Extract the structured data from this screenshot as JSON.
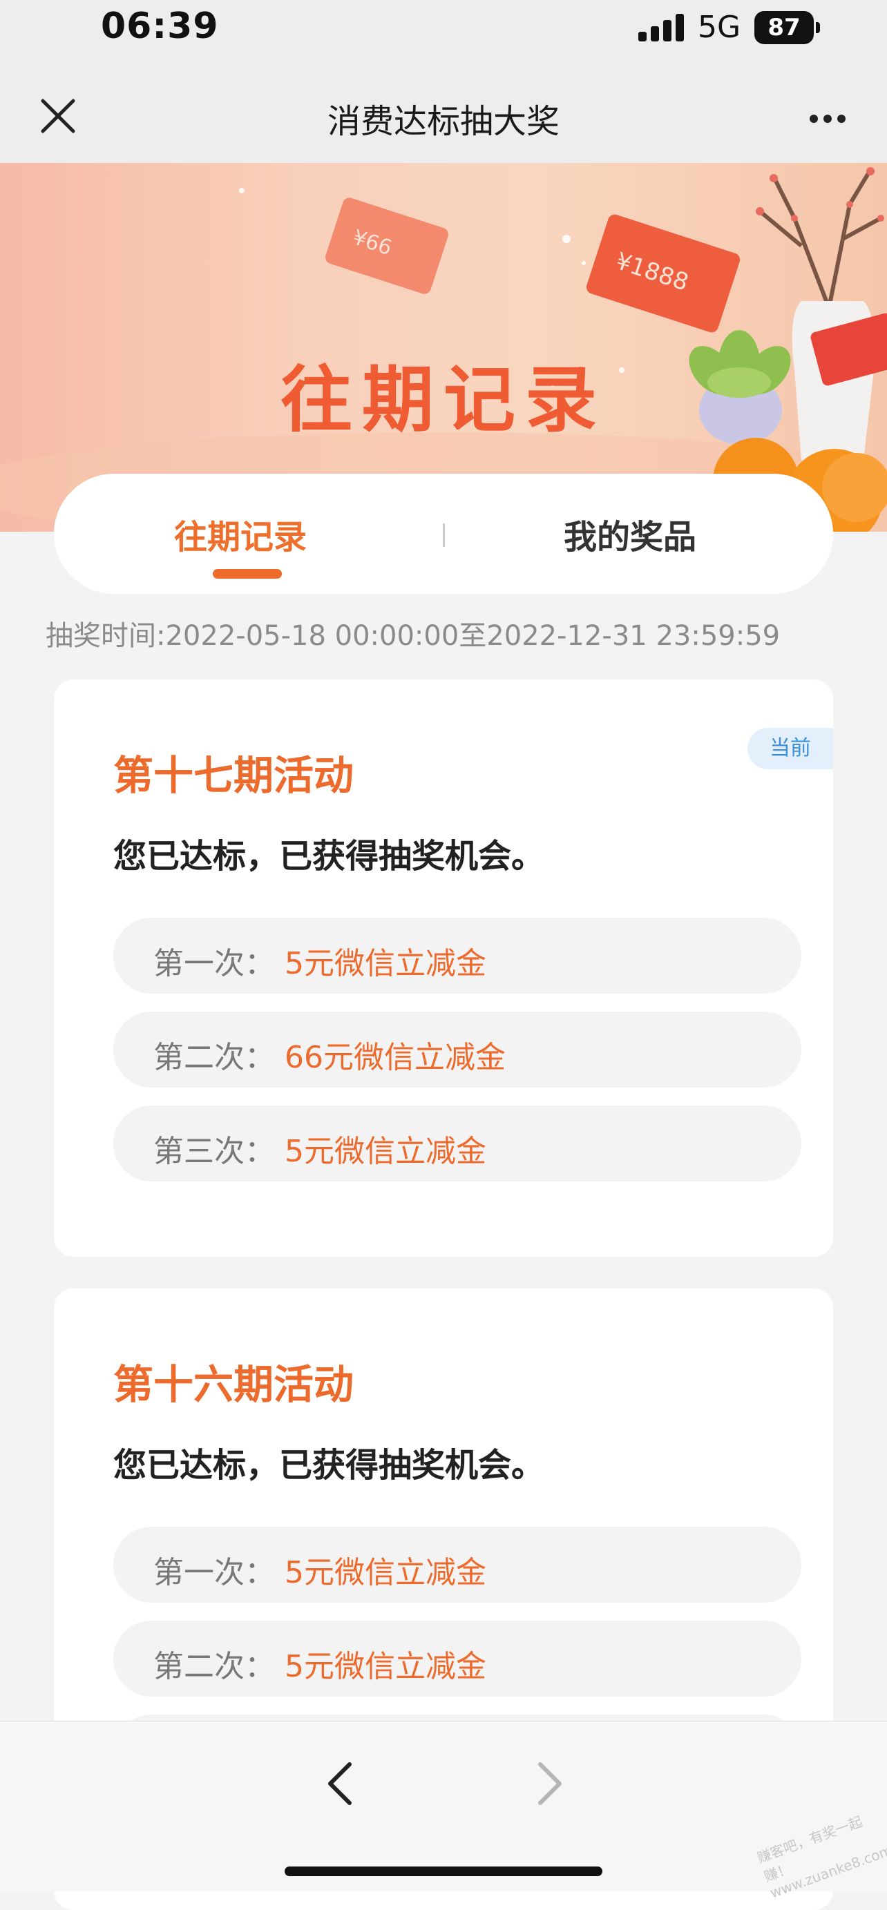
{
  "status_bar": {
    "time": "06:39",
    "network": "5G",
    "battery": "87"
  },
  "nav": {
    "title": "消费达标抽大奖",
    "close_icon": "close-icon",
    "more_icon": "more-icon"
  },
  "banner": {
    "title": "往期记录",
    "ticket_left": "¥66",
    "ticket_right": "¥1888"
  },
  "tabs": [
    {
      "label": "往期记录",
      "active": true
    },
    {
      "label": "我的奖品",
      "active": false
    }
  ],
  "draw_time": "抽奖时间:2022-05-18 00:00:00至2022-12-31 23:59:59",
  "periods": [
    {
      "title": "第十七期活动",
      "badge": "当前",
      "status": "您已达标，已获得抽奖机会。",
      "draws": [
        {
          "label": "第一次：",
          "prize": "5元微信立减金"
        },
        {
          "label": "第二次：",
          "prize": "66元微信立减金"
        },
        {
          "label": "第三次：",
          "prize": "5元微信立减金"
        }
      ]
    },
    {
      "title": "第十六期活动",
      "status": "您已达标，已获得抽奖机会。",
      "draws": [
        {
          "label": "第一次：",
          "prize": "5元微信立减金"
        },
        {
          "label": "第二次：",
          "prize": "5元微信立减金"
        }
      ]
    }
  ],
  "colors": {
    "accent": "#ec6a2b",
    "badge_text": "#3a8fd6",
    "background": "#f3f3f3"
  },
  "watermark": "赚客吧，有奖一起赚！www.zuanke8.com"
}
